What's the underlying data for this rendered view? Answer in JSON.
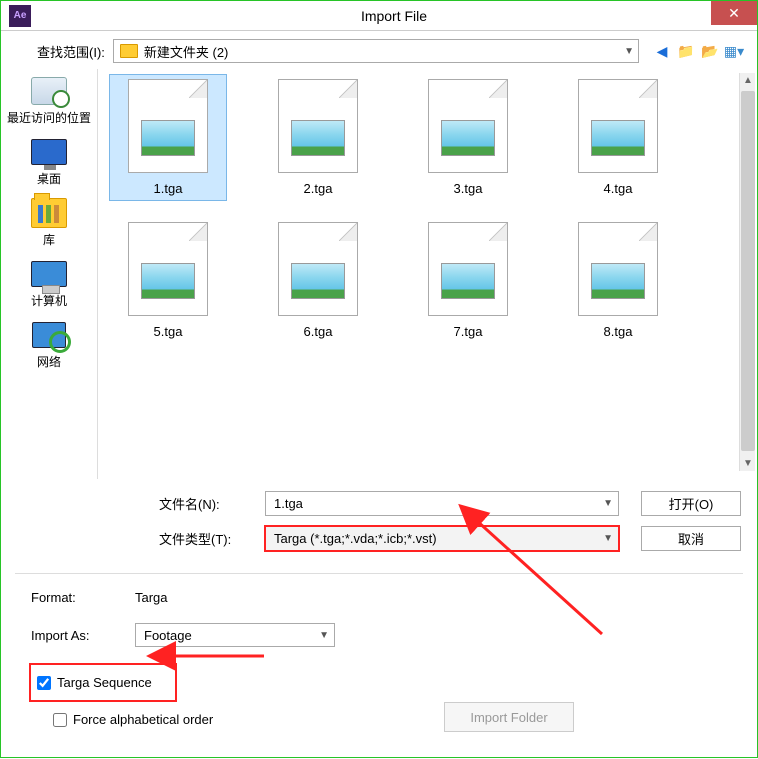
{
  "titlebar": {
    "title": "Import File"
  },
  "toolbar": {
    "lookin_label": "查找范围(I):",
    "location": "新建文件夹 (2)"
  },
  "sidebar": {
    "items": [
      {
        "label": "最近访问的位置"
      },
      {
        "label": "桌面"
      },
      {
        "label": "库"
      },
      {
        "label": "计算机"
      },
      {
        "label": "网络"
      }
    ]
  },
  "files": [
    {
      "name": "1.tga",
      "selected": true
    },
    {
      "name": "2.tga",
      "selected": false
    },
    {
      "name": "3.tga",
      "selected": false
    },
    {
      "name": "4.tga",
      "selected": false
    },
    {
      "name": "5.tga",
      "selected": false
    },
    {
      "name": "6.tga",
      "selected": false
    },
    {
      "name": "7.tga",
      "selected": false
    },
    {
      "name": "8.tga",
      "selected": false
    }
  ],
  "fields": {
    "filename_label": "文件名(N):",
    "filename_value": "1.tga",
    "filetype_label": "文件类型(T):",
    "filetype_value": "Targa (*.tga;*.vda;*.icb;*.vst)",
    "open_btn": "打开(O)",
    "cancel_btn": "取消"
  },
  "import": {
    "format_label": "Format:",
    "format_value": "Targa",
    "importas_label": "Import As:",
    "importas_value": "Footage",
    "sequence_label": "Targa Sequence",
    "force_label": "Force alphabetical order",
    "folder_btn": "Import Folder"
  }
}
